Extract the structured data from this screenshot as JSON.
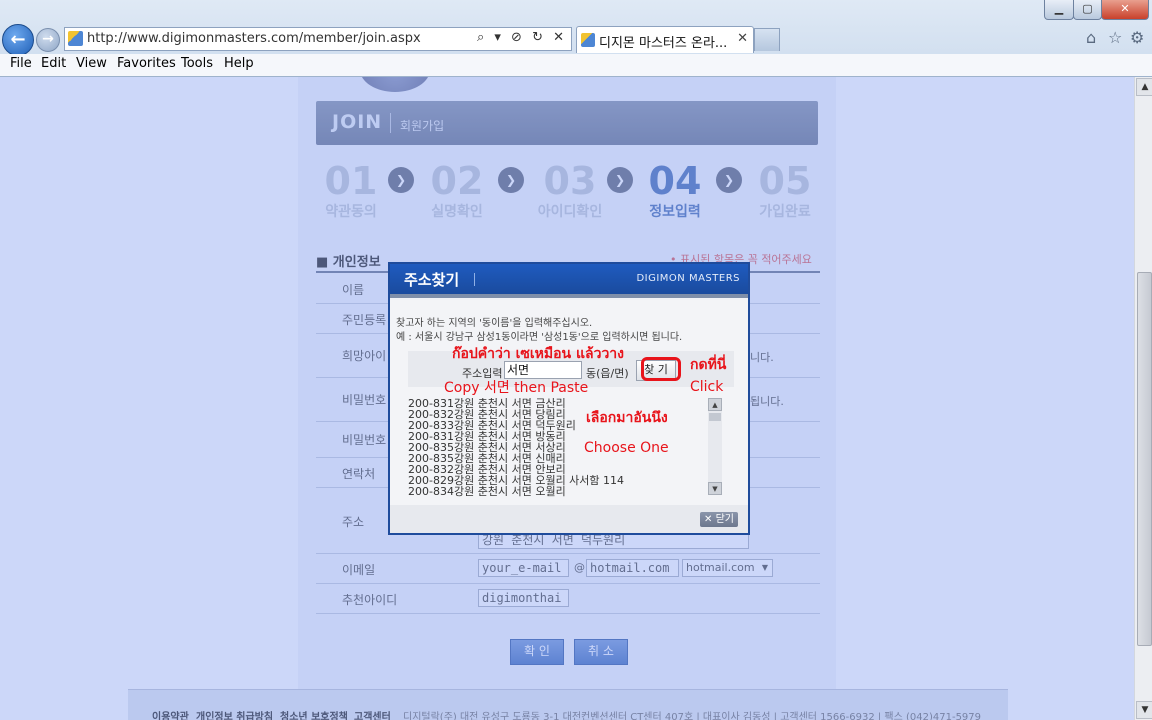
{
  "window": {
    "min_glyph": "▁",
    "max_glyph": "▢",
    "close_glyph": "✕"
  },
  "browser": {
    "back_glyph": "←",
    "forward_glyph": "→",
    "url": "http://www.digimonmasters.com/member/join.aspx",
    "address_tools": "⌕ ▾ ⊘ ↻ ✕",
    "tab_title": "디지몬 마스터즈 온라...",
    "tab_close": "✕",
    "home_icon": "⌂",
    "star_icon": "☆",
    "gear_icon": "⚙",
    "menu": [
      "File",
      "Edit",
      "View",
      "Favorites",
      "Tools",
      "Help"
    ]
  },
  "scroll": {
    "up": "▲",
    "down": "▼"
  },
  "page": {
    "join_title": "JOIN",
    "join_subtitle": "회원가입",
    "steps": [
      {
        "num": "01",
        "label": "약관동의"
      },
      {
        "num": "02",
        "label": "실명확인"
      },
      {
        "num": "03",
        "label": "아이디확인"
      },
      {
        "num": "04",
        "label": "정보입력"
      },
      {
        "num": "05",
        "label": "가입완료"
      }
    ],
    "step_arrow": "❯",
    "section_title": "■ 개인정보",
    "required_note": "• 표시된 항목은 꼭 적어주세요",
    "labels": {
      "name": "이름",
      "resident": "주민등록",
      "hope": "희망아이",
      "password": "비밀번호",
      "password_confirm": "비밀번호",
      "contact": "연락처",
      "address": "주소",
      "email": "이메일",
      "recommender": "추천아이디"
    },
    "notes": {
      "hope": "니다.",
      "password": "됩니다."
    },
    "address_value": "강원 춘천시 서면 덕두원리",
    "email_id": "your_e-mail",
    "email_at": "@",
    "email_domain": "hotmail.com",
    "email_select": "hotmail.com",
    "email_select_arrow": "▼",
    "recommender_value": "digimonthai",
    "confirm_button": "확 인",
    "cancel_button": "취 소",
    "footer_links": [
      "이용약관",
      "개인정보 취급방침",
      "청소년 보호정책",
      "고객센터"
    ],
    "footer_company": "디지털락(주) 대전 유성구 도룡동 3-1 대전컨벤션센터 CT센터 407호 | 대표이사 김동성 | 고객센터 1566-6932 | 팩스 (042)471-5979"
  },
  "modal": {
    "title": "주소찾기",
    "brand": "DIGIMON MASTERS",
    "instruction1": "찾고자 하는 지역의 '동이름'을 입력해주십시오.",
    "instruction2": "예 : 서울시 강남구 삼성1동이라면 '삼성1동'으로 입력하시면 됩니다.",
    "search_label": "주소입력",
    "search_value": "서면",
    "search_suffix": "동(읍/면)",
    "search_button": "찾 기",
    "results": [
      {
        "code": "200-831",
        "addr": "강원 춘천시 서면 금산리"
      },
      {
        "code": "200-832",
        "addr": "강원 춘천시 서면 당림리"
      },
      {
        "code": "200-833",
        "addr": "강원 춘천시 서면 덕두원리"
      },
      {
        "code": "200-831",
        "addr": "강원 춘천시 서면 방동리"
      },
      {
        "code": "200-835",
        "addr": "강원 춘천시 서면 서상리"
      },
      {
        "code": "200-835",
        "addr": "강원 춘천시 서면 신매리"
      },
      {
        "code": "200-832",
        "addr": "강원 춘천시 서면 안보리"
      },
      {
        "code": "200-829",
        "addr": "강원 춘천시 서면 오월리 사서함  114"
      },
      {
        "code": "200-834",
        "addr": "강원 춘천시 서면 오월리"
      }
    ],
    "list_up": "▲",
    "list_down": "▼",
    "close_button": "✕ 닫기"
  },
  "annotations": {
    "copy_thai": "ก๊อปคำว่า เซเหมือน แล้ววาง",
    "copy_en": "Copy  서면  then Paste",
    "click_thai": "กดที่นี่",
    "click_en": "Click",
    "choose_thai": "เลือกมาอันนึง",
    "choose_en": "Choose One"
  },
  "colors": {
    "overlay": "#7896f0",
    "modal_header": "#1f5bbf",
    "annotation": "#e8141b"
  }
}
